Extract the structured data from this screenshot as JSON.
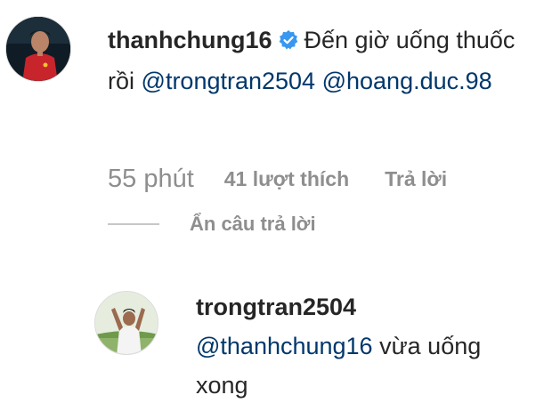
{
  "comment": {
    "username": "thanhchung16",
    "text": "Đến giờ uống thuốc rồi",
    "mention_1": "@trongtran2504",
    "mention_2": "@hoang.duc.98",
    "time": "55 phút",
    "likes": "41 lượt thích",
    "reply_label": "Trả lời",
    "hide_replies": "Ẩn câu trả lời",
    "verified_icon": "verified-badge-icon",
    "verified_color": "#3897f0"
  },
  "reply": {
    "username": "trongtran2504",
    "mention": "@thanhchung16",
    "text_line1": "vừa uống",
    "text_line2": "xong"
  },
  "colors": {
    "text": "#262626",
    "secondary": "#8e8e8e",
    "mention": "#00376b"
  }
}
